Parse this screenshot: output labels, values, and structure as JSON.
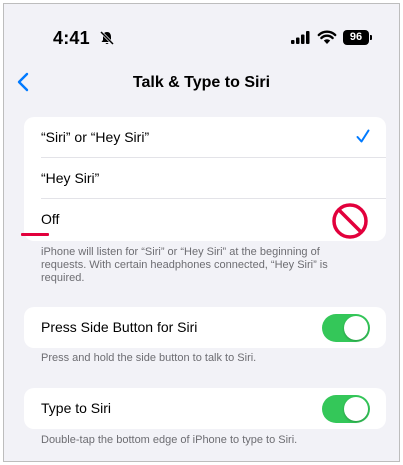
{
  "status_bar": {
    "time": "4:41",
    "battery": "96"
  },
  "nav": {
    "title": "Talk & Type to Siri"
  },
  "listen_options": {
    "items": [
      {
        "label": "“Siri” or “Hey Siri”",
        "selected": true
      },
      {
        "label": "“Hey Siri”",
        "selected": false
      },
      {
        "label": "Off",
        "selected": false
      }
    ],
    "footer_line1": "iPhone will listen for “Siri” or “Hey Siri” at the beginning of",
    "footer_line2": "requests. With certain headphones connected, “Hey Siri” is",
    "footer_line3": "required."
  },
  "side_button": {
    "label": "Press Side Button for Siri",
    "enabled": true,
    "footer": "Press and hold the side button to talk to Siri."
  },
  "type_to_siri": {
    "label": "Type to Siri",
    "enabled": true,
    "footer": "Double-tap the bottom edge of iPhone to type to Siri."
  },
  "colors": {
    "accent": "#007aff",
    "toggle_on": "#34c759",
    "annotation_red": "#e2003c"
  }
}
